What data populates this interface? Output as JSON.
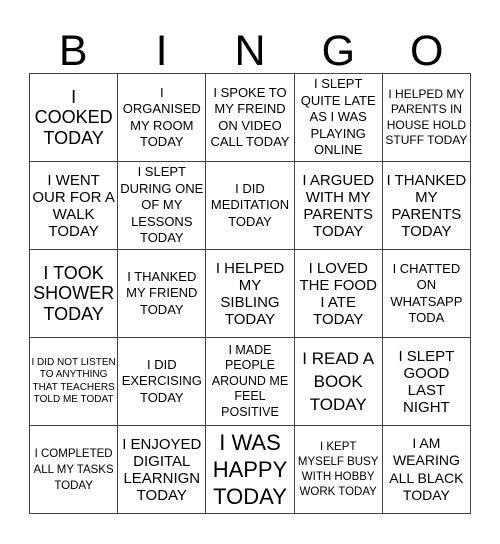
{
  "header": {
    "letters": [
      "B",
      "I",
      "N",
      "G",
      "O"
    ]
  },
  "cells": [
    [
      "I COOKED TODAY",
      "I ORGANISED MY ROOM TODAY",
      "I SPOKE TO MY FREIND ON VIDEO CALL TODAY",
      "I SLEPT QUITE LATE AS I WAS PLAYING ONLINE",
      "I HELPED MY PARENTS IN HOUSE HOLD STUFF TODAY"
    ],
    [
      "I WENT OUR FOR A WALK TODAY",
      "I SLEPT DURING ONE OF MY LESSONS TODAY",
      "I DID MEDITATION TODAY",
      "I ARGUED WITH MY PARENTS TODAY",
      "I THANKED MY PARENTS TODAY"
    ],
    [
      "I TOOK SHOWER TODAY",
      "I THANKED MY FRIEND TODAY",
      "I HELPED MY SIBLING TODAY",
      "I LOVED THE FOOD I ATE TODAY",
      "I CHATTED ON WHATSAPP TODA"
    ],
    [
      "I DID NOT LISTEN TO ANYTHING THAT TEACHERS TOLD ME TODAT",
      "I DID EXERCISING TODAY",
      "I MADE PEOPLE AROUND ME FEEL POSITIVE",
      "I READ A BOOK TODAY",
      "I SLEPT GOOD LAST NIGHT"
    ],
    [
      "I COMPLETED ALL MY TASKS TODAY",
      "I ENJOYED DIGITAL LEARNIGN TODAY",
      "I WAS HAPPY TODAY",
      "I KEPT MYSELF BUSY WITH HOBBY WORK TODAY",
      "I AM WEARING ALL BLACK TODAY"
    ]
  ]
}
